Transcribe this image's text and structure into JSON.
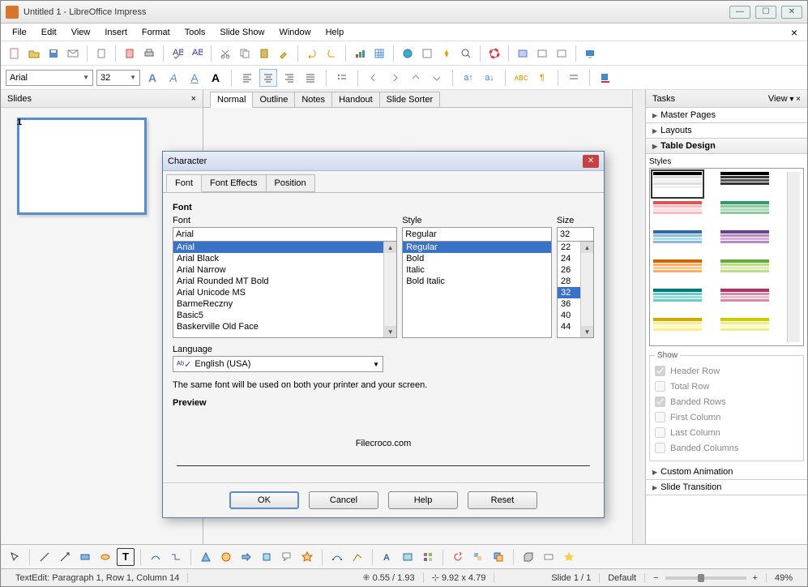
{
  "window": {
    "title": "Untitled 1 - LibreOffice Impress"
  },
  "menu": {
    "file": "File",
    "edit": "Edit",
    "view": "View",
    "insert": "Insert",
    "format": "Format",
    "tools": "Tools",
    "slideshow": "Slide Show",
    "window": "Window",
    "help": "Help"
  },
  "fmt": {
    "font": "Arial",
    "size": "32"
  },
  "slidePanel": {
    "title": "Slides",
    "num": "1"
  },
  "viewTabs": {
    "normal": "Normal",
    "outline": "Outline",
    "notes": "Notes",
    "handout": "Handout",
    "sorter": "Slide Sorter"
  },
  "tasks": {
    "title": "Tasks",
    "view": "View",
    "master": "Master Pages",
    "layouts": "Layouts",
    "tableDesign": "Table Design",
    "stylesLabel": "Styles",
    "show": {
      "label": "Show",
      "header": "Header Row",
      "total": "Total Row",
      "banded": "Banded Rows",
      "first": "First Column",
      "last": "Last Column",
      "bandedCols": "Banded Columns"
    },
    "customAnim": "Custom Animation",
    "slideTrans": "Slide Transition"
  },
  "dialog": {
    "title": "Character",
    "tabs": {
      "font": "Font",
      "effects": "Font Effects",
      "position": "Position"
    },
    "sectFont": "Font",
    "cols": {
      "font": "Font",
      "style": "Style",
      "size": "Size"
    },
    "fontInput": "Arial",
    "fontList": [
      "Arial",
      "Arial Black",
      "Arial Narrow",
      "Arial Rounded MT Bold",
      "Arial Unicode MS",
      "BarmeReczny",
      "Basic5",
      "Baskerville Old Face"
    ],
    "styleInput": "Regular",
    "styleList": [
      "Regular",
      "Bold",
      "Italic",
      "Bold Italic"
    ],
    "sizeInput": "32",
    "sizeList": [
      "22",
      "24",
      "26",
      "28",
      "32",
      "36",
      "40",
      "44"
    ],
    "langLabel": "Language",
    "lang": "English (USA)",
    "note": "The same font will be used on both your printer and your screen.",
    "previewLabel": "Preview",
    "previewText": "Filecroco.com",
    "btns": {
      "ok": "OK",
      "cancel": "Cancel",
      "help": "Help",
      "reset": "Reset"
    }
  },
  "status": {
    "text": "TextEdit: Paragraph 1, Row 1, Column 14",
    "pos": "0.55 / 1.93",
    "dim": "9.92 x 4.79",
    "slide": "Slide 1 / 1",
    "layout": "Default",
    "zoom": "49%"
  }
}
